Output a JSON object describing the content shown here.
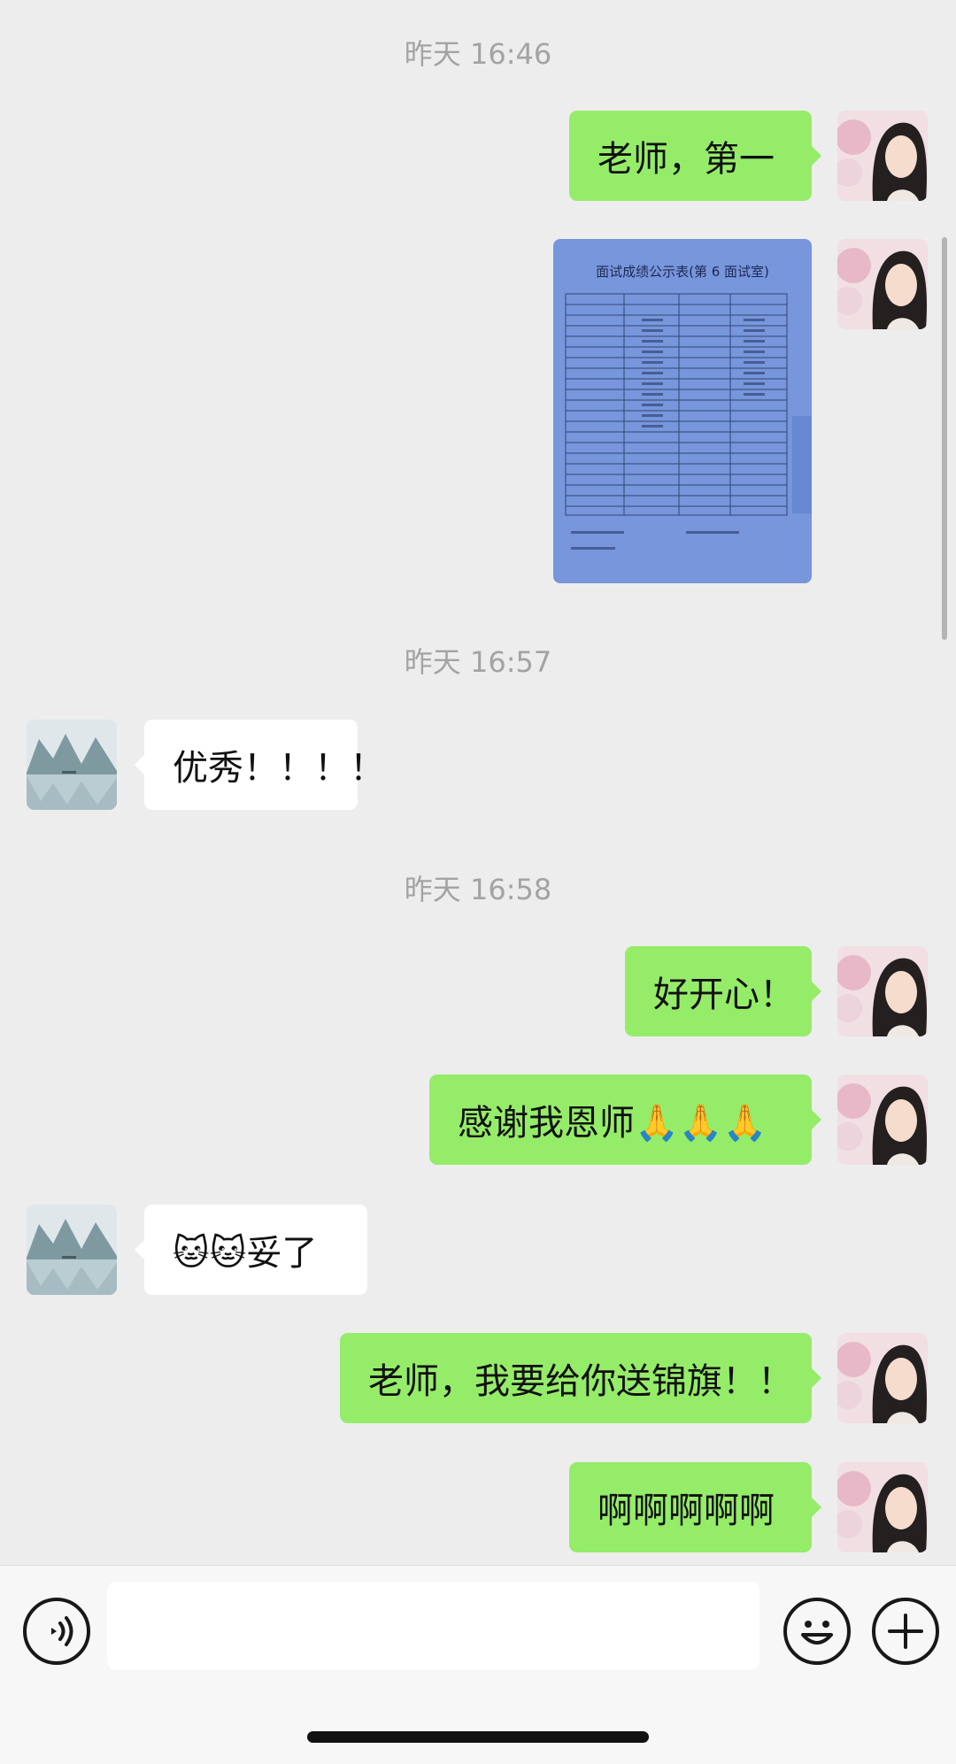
{
  "chat": {
    "timestamps": [
      "昨天 16:46",
      "昨天 16:57",
      "昨天 16:58"
    ],
    "messages": [
      {
        "sender": "me",
        "type": "text",
        "text": "老师，第一"
      },
      {
        "sender": "me",
        "type": "image",
        "image_title": "面试成绩公示表(第 6 面试室)"
      },
      {
        "sender": "teacher",
        "type": "text",
        "text": "优秀！！！！"
      },
      {
        "sender": "me",
        "type": "text",
        "text": "好开心！"
      },
      {
        "sender": "me",
        "type": "text",
        "text": "感谢我恩师🙏🙏🙏"
      },
      {
        "sender": "teacher",
        "type": "text",
        "text": "🐱🐱妥了"
      },
      {
        "sender": "me",
        "type": "text",
        "text": "老师，我要给你送锦旗！！"
      },
      {
        "sender": "me",
        "type": "text",
        "text": "啊啊啊啊啊"
      }
    ]
  },
  "colors": {
    "background": "#ededed",
    "outgoing_bubble": "#95ec69",
    "incoming_bubble": "#ffffff",
    "timestamp_text": "#a3a3a3",
    "input_bar": "#f7f7f7"
  },
  "input_bar": {
    "voice_icon": "voice-icon",
    "emoji_icon": "emoji-icon",
    "plus_icon": "plus-icon",
    "text_value": ""
  }
}
